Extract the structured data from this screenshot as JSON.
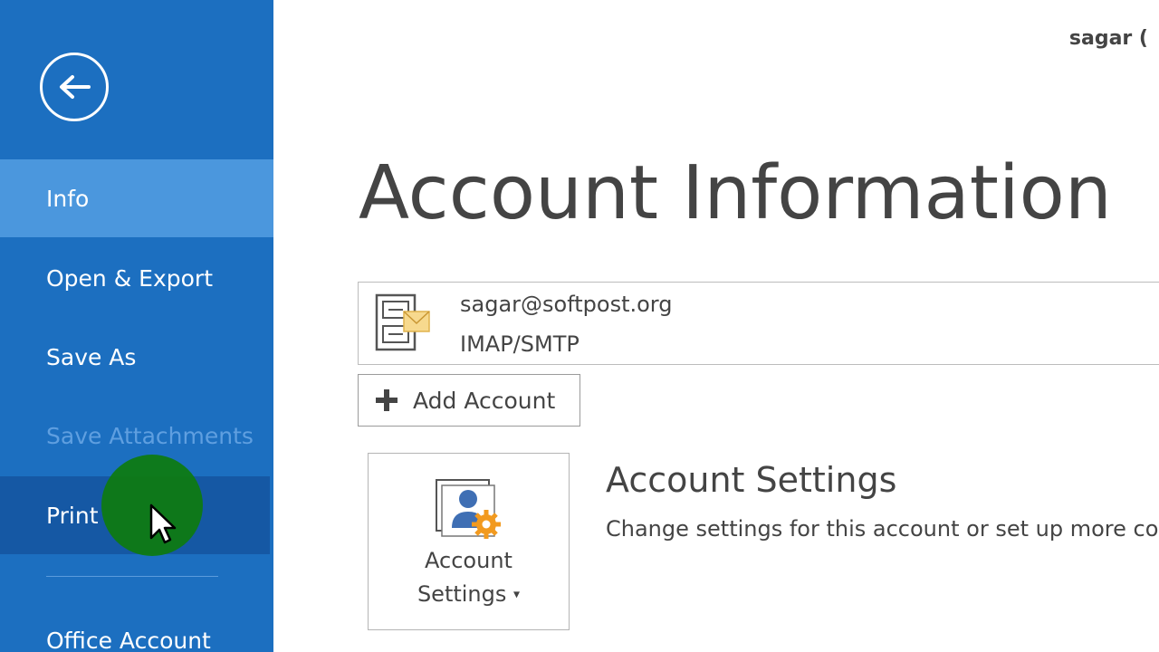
{
  "sidebar": {
    "items": [
      {
        "label": "Info"
      },
      {
        "label": "Open & Export"
      },
      {
        "label": "Save As"
      },
      {
        "label": "Save Attachments"
      },
      {
        "label": "Print"
      },
      {
        "label": "Office Account"
      }
    ],
    "back_icon": "back-arrow-icon"
  },
  "header": {
    "user_name": "sagar ("
  },
  "main": {
    "title": "Account Information",
    "account": {
      "email": "sagar@softpost.org",
      "type": "IMAP/SMTP",
      "icon": "account-file-icon"
    },
    "add_account_label": "Add Account",
    "account_settings": {
      "button_line1": "Account",
      "button_line2": "Settings",
      "title": "Account Settings",
      "description": "Change settings for this account or set up more co"
    }
  },
  "colors": {
    "sidebar_bg": "#1c6fc0",
    "sidebar_selected": "#4b97dd",
    "sidebar_hover": "#1558a4",
    "text": "#444444",
    "pointer_highlight": "#0e7a13",
    "icon_orange": "#f29a1f"
  }
}
